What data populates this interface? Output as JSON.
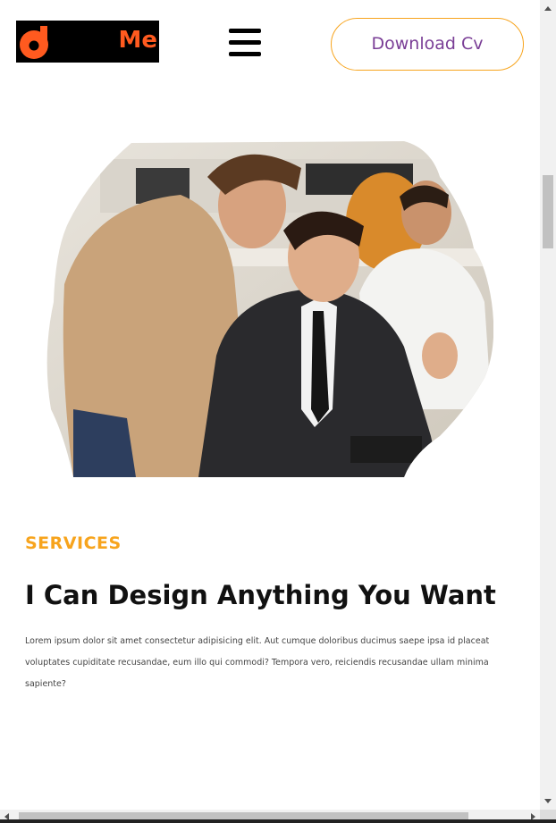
{
  "header": {
    "logo_text": "Me",
    "logo_mark_icon": "orange-d-logo",
    "menu_icon": "hamburger-menu-icon",
    "download_label": "Download Cv"
  },
  "hero": {
    "image_description_icon": "team-office-photo"
  },
  "services": {
    "label": "SERVICES",
    "title": "I Can Design Anything You Want",
    "description": "Lorem ipsum dolor sit amet consectetur adipisicing elit. Aut cumque doloribus ducimus saepe ipsa id placeat voluptates cupiditate recusandae, eum illo qui commodi? Tempora vero, reiciendis recusandae ullam minima sapiente?"
  },
  "colors": {
    "accent_orange": "#f7a41d",
    "logo_orange": "#ff5a1f",
    "button_text": "#7a3e96",
    "title_text": "#111111"
  }
}
